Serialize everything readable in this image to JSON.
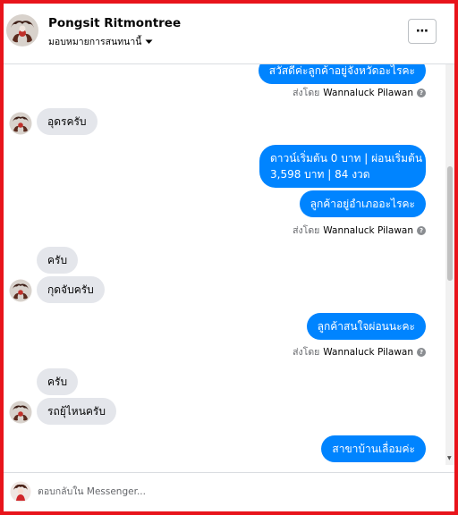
{
  "header": {
    "name": "Pongsit Ritmontree",
    "assign_label": "มอบหมายการสนทนานี้",
    "more_label": "⋯"
  },
  "messages": {
    "m1_cut": "สวัสดีค่ะลูกค้าอยู่จังหวัดอะไรคะ",
    "s1": {
      "prefix": "ส่งโดย",
      "name": "Wannaluck Pilawan"
    },
    "in1": "อุดรครับ",
    "out2_line1": "ดาวน์เริ่มต้น 0 บาท | ผ่อนเริ่มต้น",
    "out2_line2": "3,598 บาท  | 84 งวด",
    "out3": "ลูกค้าอยู่อำเภออะไรคะ",
    "s2": {
      "prefix": "ส่งโดย",
      "name": "Wannaluck Pilawan"
    },
    "in2": "ครับ",
    "in3": "กุดจับครับ",
    "out4": "ลูกค้าสนใจผ่อนนะคะ",
    "s3": {
      "prefix": "ส่งโดย",
      "name": "Wannaluck Pilawan"
    },
    "in4": "ครับ",
    "in5": "รถยุ้ไหนครับ",
    "out5": "สาขาบ้านเลื่อมค่ะ"
  },
  "footer": {
    "placeholder": "ตอบกลับใน Messenger..."
  },
  "colors": {
    "brand_blue": "#0084ff",
    "incoming_bubble": "#e4e6eb",
    "frame_red": "#e8141b"
  },
  "icons": {
    "info": "info-icon",
    "chevron": "chevron-down-icon",
    "more": "more-icon"
  }
}
